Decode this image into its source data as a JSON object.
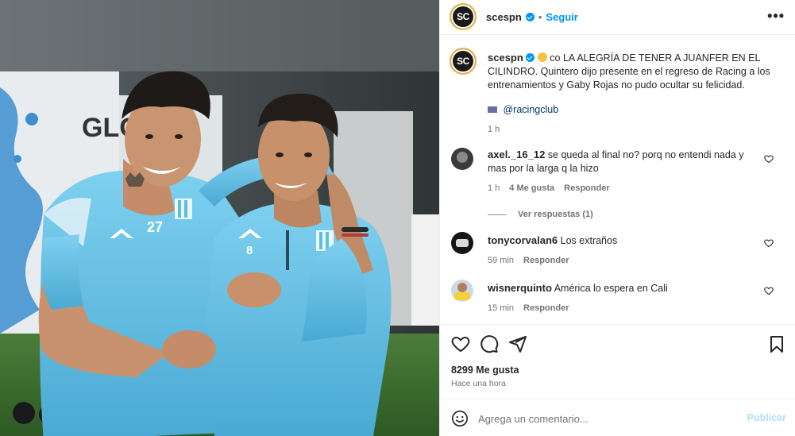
{
  "post": {
    "author": "scespn",
    "avatar_text": "SC",
    "separator": "•",
    "follow_label": "Seguir",
    "more_label": "•••",
    "caption_prefix": "co",
    "caption_text": "LA ALEGRÍA DE TENER A JUANFER EN EL CILINDRO. Quintero dijo presente en el regreso de Racing a los entrenamientos y Gaby Rojas no pudo ocultar su felicidad.",
    "caption_mention": "@racingclub",
    "caption_time": "1 h",
    "likes": "8299 Me gusta",
    "posted": "Hace una hora"
  },
  "comments": [
    {
      "user": "axel._16_12",
      "text": "se queda al final no? porq no entendi nada y mas por la larga q la hizo",
      "time": "1 h",
      "likes": "4 Me gusta",
      "reply": "Responder",
      "view_replies": "Ver respuestas (1)"
    },
    {
      "user": "tonycorvalan6",
      "text": "Los extraños",
      "time": "59 min",
      "reply": "Responder"
    },
    {
      "user": "wisnerquinto",
      "text": "América lo espera en Cali",
      "time": "15 min",
      "reply": "Responder"
    }
  ],
  "photo": {
    "sign_text": "GLO",
    "jersey_numbers": [
      "27",
      "8"
    ]
  },
  "composer": {
    "placeholder": "Agrega un comentario...",
    "publish_label": "Publicar"
  },
  "icons": {
    "like": "heart-icon",
    "comment": "comment-icon",
    "share": "paper-plane-icon",
    "save": "bookmark-icon",
    "emoji": "smiley-icon",
    "verified": "verified-badge-icon",
    "more": "more-options-icon"
  },
  "colors": {
    "accent": "#0095f6",
    "jersey": "#5bbfe4",
    "publish_disabled": "#b2dffc"
  }
}
